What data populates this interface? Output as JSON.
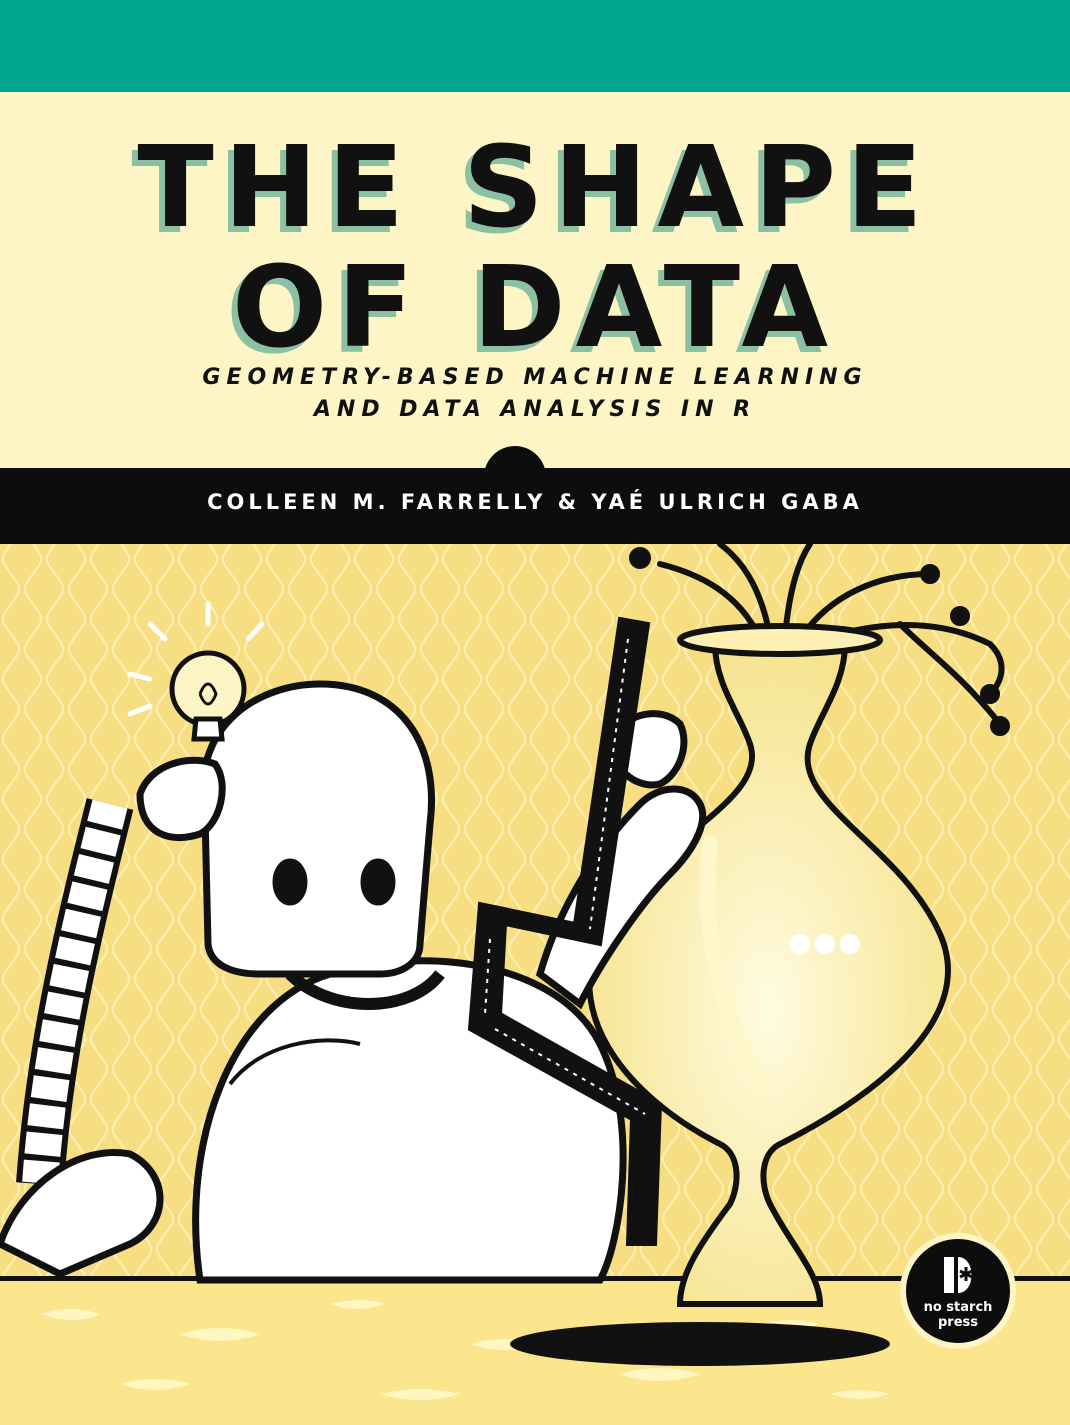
{
  "cover": {
    "title_line1": "THE SHAPE",
    "title_line2": "OF DATA",
    "subtitle_line1": "GEOMETRY-BASED MACHINE LEARNING",
    "subtitle_line2": "AND DATA ANALYSIS IN R",
    "authors": "COLLEEN M. FARRELLY & YAÉ ULRICH GABA"
  },
  "publisher": {
    "name_line1": "no starch",
    "name_line2": "press"
  },
  "colors": {
    "top_band": "#00a78e",
    "title_background": "#fdf5c6",
    "title_shadow": "#8cc0a3",
    "author_band": "#0d0d0d",
    "wallpaper": "#f7de82",
    "table": "#fbe68e",
    "ink": "#111111"
  },
  "icons": [
    "lightbulb-icon",
    "robot-icon",
    "ruler-icon",
    "vase-icon",
    "plant-icon",
    "publisher-logo-icon"
  ]
}
